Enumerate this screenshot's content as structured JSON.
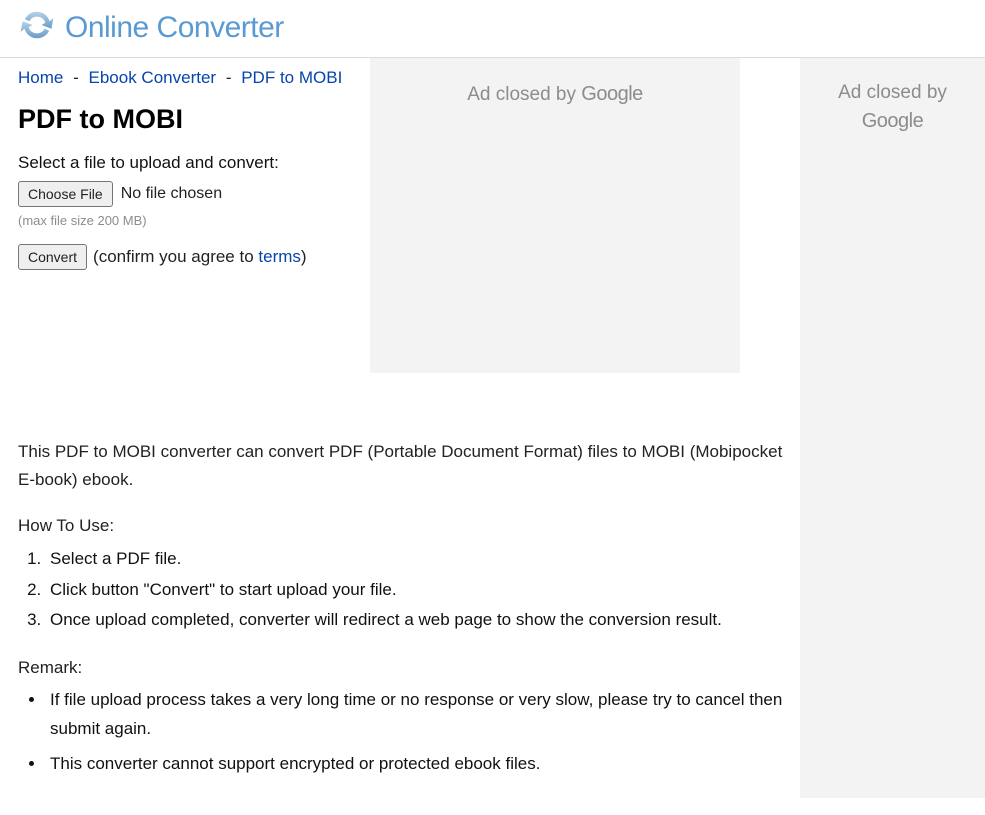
{
  "header": {
    "site_title": "Online Converter"
  },
  "breadcrumb": {
    "home": "Home",
    "ebook": "Ebook Converter",
    "current": "PDF to MOBI",
    "sep": "-"
  },
  "page": {
    "title": "PDF to MOBI"
  },
  "form": {
    "select_label": "Select a file to upload and convert:",
    "choose_file_btn": "Choose File",
    "no_file_text": "No file chosen",
    "max_size": "(max file size 200 MB)",
    "convert_btn": "Convert",
    "confirm_prefix": "(confirm you agree to ",
    "terms_label": "terms",
    "confirm_suffix": ")"
  },
  "ads": {
    "closed_text_prefix": "Ad closed by ",
    "google": "Google"
  },
  "description": {
    "intro": "This PDF to MOBI converter can convert PDF (Portable Document Format) files to MOBI (Mobipocket E-book) ebook.",
    "howto_label": "How To Use:",
    "steps": [
      "Select a PDF file.",
      "Click button \"Convert\" to start upload your file.",
      "Once upload completed, converter will redirect a web page to show the conversion result."
    ],
    "remark_label": "Remark:",
    "remarks": [
      "If file upload process takes a very long time or no response or very slow, please try to cancel then submit again.",
      "This converter cannot support encrypted or protected ebook files."
    ]
  }
}
